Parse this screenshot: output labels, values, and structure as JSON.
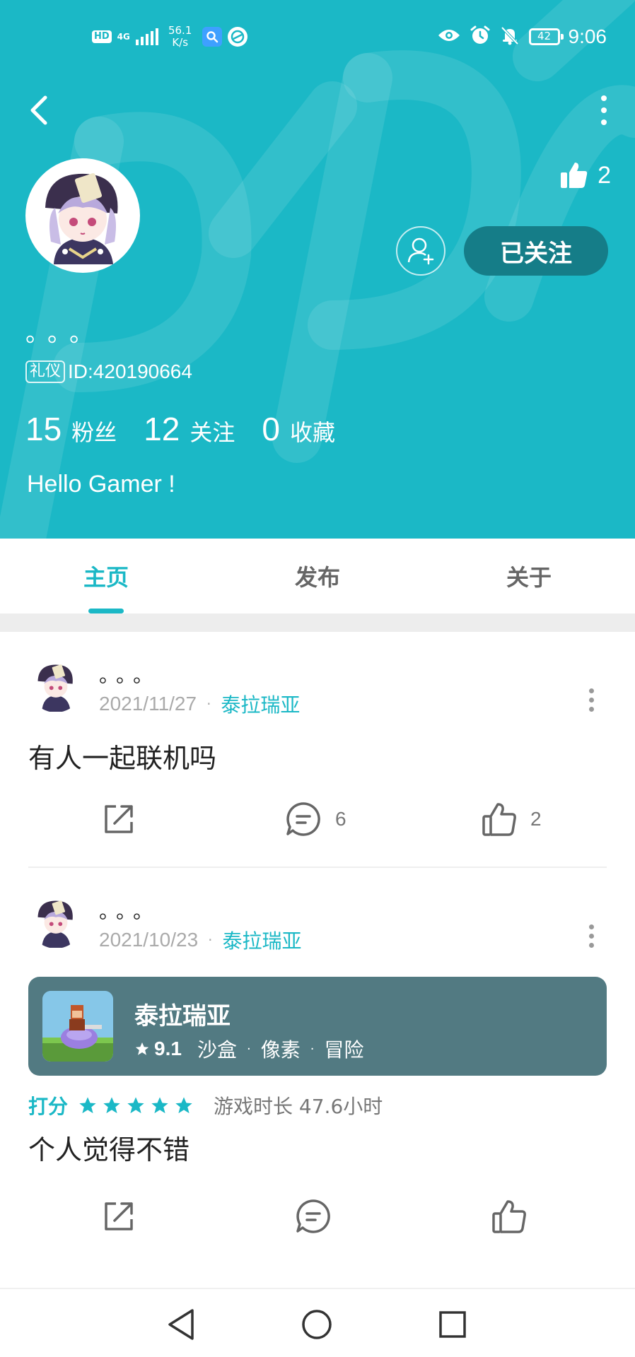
{
  "status_bar": {
    "hd": "HD",
    "network": "4G",
    "speed_value": "56.1",
    "speed_unit": "K/s",
    "battery": "42",
    "time": "9:06"
  },
  "header": {
    "like_count": "2",
    "follow_label": "已关注",
    "nickname": "。。。",
    "id_badge": "礼仪",
    "id_text": "ID:420190664",
    "stats": [
      {
        "count": "15",
        "label": "粉丝"
      },
      {
        "count": "12",
        "label": "关注"
      },
      {
        "count": "0",
        "label": "收藏"
      }
    ],
    "bio": "Hello Gamer !"
  },
  "tabs": [
    {
      "label": "主页",
      "active": true
    },
    {
      "label": "发布",
      "active": false
    },
    {
      "label": "关于",
      "active": false
    }
  ],
  "posts": [
    {
      "author": "。。。",
      "date": "2021/11/27",
      "game": "泰拉瑞亚",
      "text": "有人一起联机吗",
      "comments": "6",
      "likes": "2"
    },
    {
      "author": "。。。",
      "date": "2021/10/23",
      "game": "泰拉瑞亚",
      "card": {
        "name": "泰拉瑞亚",
        "score": "9.1",
        "tags": [
          "沙盒",
          "像素",
          "冒险"
        ]
      },
      "rating_label": "打分",
      "stars": 5,
      "playtime": "游戏时长 47.6小时",
      "text": "个人觉得不错"
    }
  ],
  "colors": {
    "accent": "#1bb8c6",
    "follow_button": "#157d88",
    "game_card": "#527a82"
  }
}
